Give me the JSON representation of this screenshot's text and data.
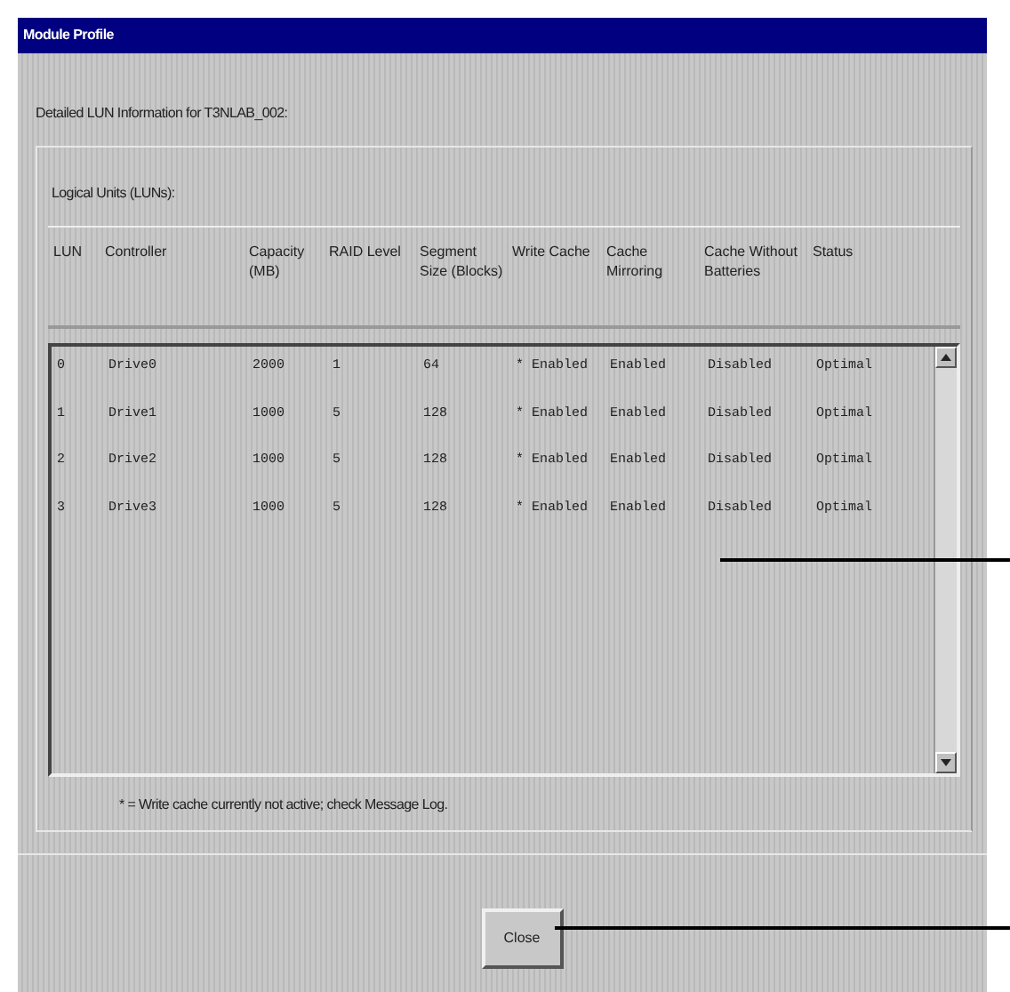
{
  "window": {
    "title": "Module Profile"
  },
  "heading": "Detailed LUN Information for T3NLAB_002:",
  "group_label": "Logical Units (LUNs):",
  "table": {
    "columns": [
      "LUN",
      "Controller",
      "Capacity (MB)",
      "RAID Level",
      "Segment Size (Blocks)",
      "Write Cache",
      "Cache Mirroring",
      "Cache Without Batteries",
      "Status"
    ],
    "rows": [
      [
        "0",
        "Drive0",
        "2000",
        "1",
        "64",
        "* Enabled",
        "Enabled",
        "Disabled",
        "Optimal"
      ],
      [
        "1",
        "Drive1",
        "1000",
        "5",
        "128",
        "* Enabled",
        "Enabled",
        "Disabled",
        "Optimal"
      ],
      [
        "2",
        "Drive2",
        "1000",
        "5",
        "128",
        "* Enabled",
        "Enabled",
        "Disabled",
        "Optimal"
      ],
      [
        "3",
        "Drive3",
        "1000",
        "5",
        "128",
        "* Enabled",
        "Enabled",
        "Disabled",
        "Optimal"
      ]
    ]
  },
  "footnote": "* = Write cache currently not active; check Message Log.",
  "buttons": [
    "Close"
  ]
}
